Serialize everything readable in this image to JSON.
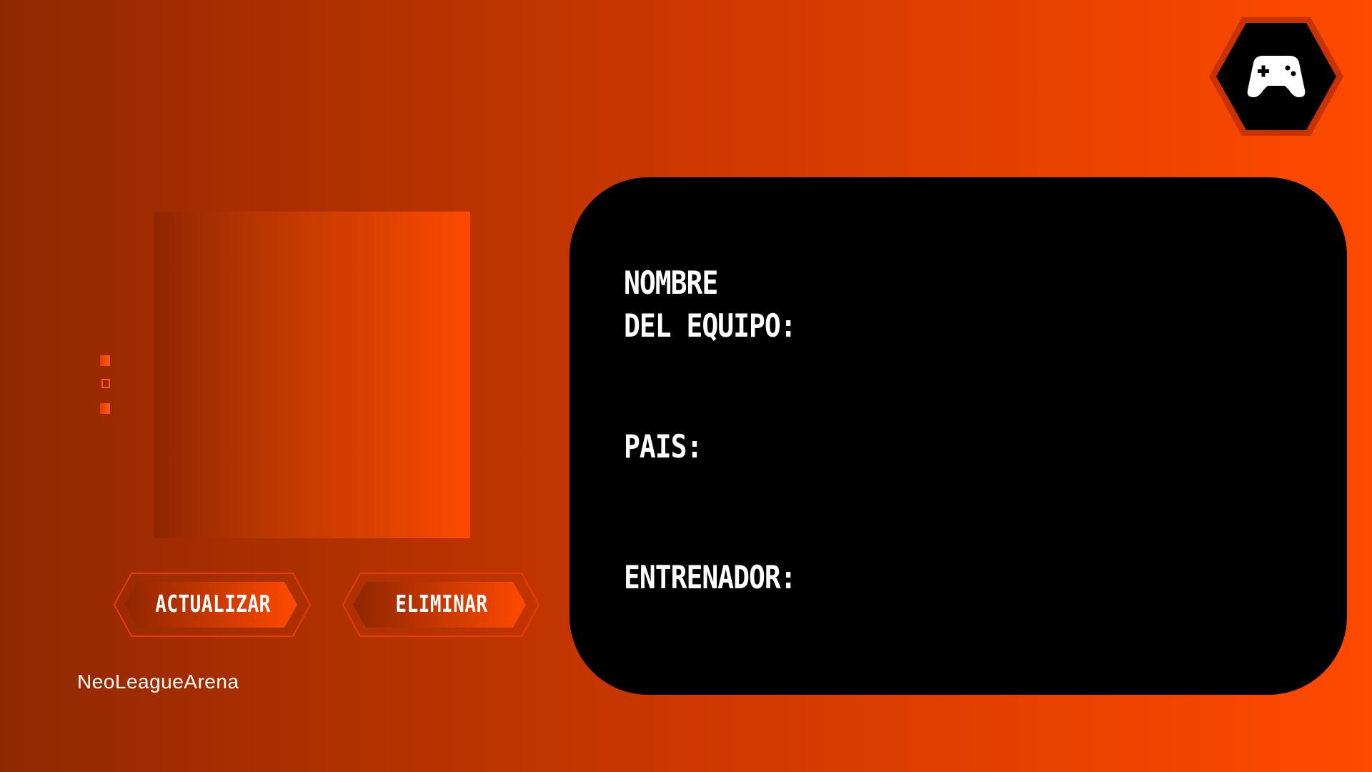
{
  "logo": {
    "icon": "gamepad-icon",
    "hex_fill": "#000000",
    "hex_stroke": "#c83100"
  },
  "buttons": {
    "update_label": "ACTUALIZAR",
    "delete_label": "ELIMINAR"
  },
  "brand": {
    "name": "NeoLeagueArena"
  },
  "card": {
    "name_label_line1": "NOMBRE",
    "name_label_line2": "DEL EQUIPO:",
    "country_label": "PAIS:",
    "coach_label": "ENTRENADOR:",
    "name_value": "",
    "country_value": "",
    "coach_value": ""
  },
  "colors": {
    "accent": "#ff4a00",
    "dark_accent": "#8f2800",
    "card_bg": "#000000",
    "text": "#ffffff"
  }
}
